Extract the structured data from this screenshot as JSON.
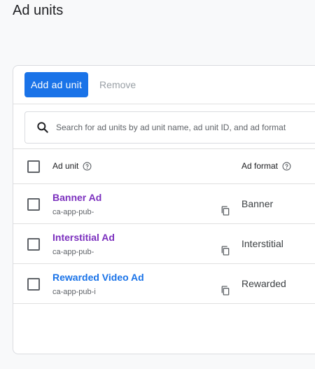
{
  "page": {
    "title": "Ad units"
  },
  "toolbar": {
    "add_label": "Add ad unit",
    "remove_label": "Remove"
  },
  "search": {
    "placeholder": "Search for ad units by ad unit name, ad unit ID, and ad format"
  },
  "table": {
    "columns": {
      "ad_unit": "Ad unit",
      "ad_format": "Ad format"
    },
    "rows": [
      {
        "name": "Banner Ad",
        "id": "ca-app-pub-",
        "format": "Banner",
        "name_color": "#7b2fbe"
      },
      {
        "name": "Interstitial Ad",
        "id": "ca-app-pub-",
        "format": "Interstitial",
        "name_color": "#7b2fbe"
      },
      {
        "name": "Rewarded Video Ad",
        "id": "ca-app-pub-i",
        "format": "Rewarded",
        "name_color": "#1a73e8"
      }
    ]
  },
  "colors": {
    "primary": "#1a73e8",
    "visited_link": "#7b2fbe",
    "link": "#1a73e8"
  },
  "icons": {
    "search": "search-icon",
    "help": "help-icon",
    "copy": "copy-icon"
  }
}
